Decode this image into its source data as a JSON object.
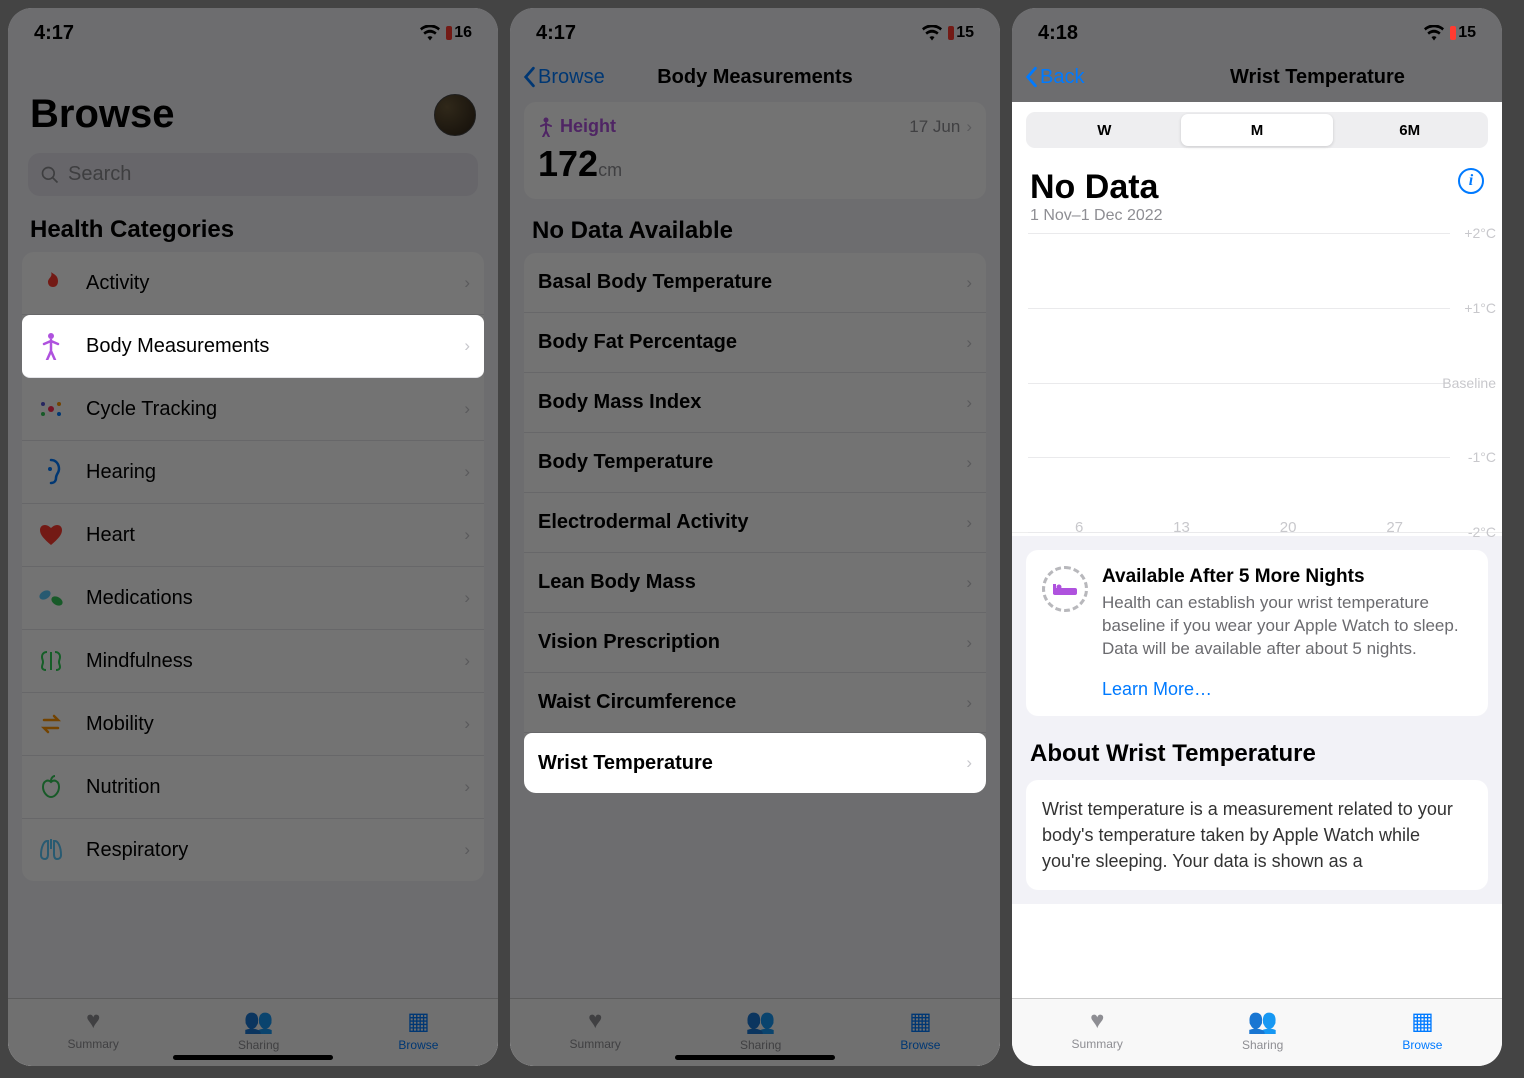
{
  "panel1": {
    "status": {
      "time": "4:17",
      "battery": "16"
    },
    "title": "Browse",
    "search_placeholder": "Search",
    "section": "Health Categories",
    "categories": [
      {
        "icon": "flame",
        "label": "Activity",
        "color": "#ff3b30"
      },
      {
        "icon": "body",
        "label": "Body Measurements",
        "color": "#af52de",
        "highlight": true
      },
      {
        "icon": "cycle",
        "label": "Cycle Tracking",
        "color": "#ff2d55"
      },
      {
        "icon": "ear",
        "label": "Hearing",
        "color": "#007aff"
      },
      {
        "icon": "heart",
        "label": "Heart",
        "color": "#ff3b30"
      },
      {
        "icon": "pills",
        "label": "Medications",
        "color": "#34c759"
      },
      {
        "icon": "brain",
        "label": "Mindfulness",
        "color": "#30d158"
      },
      {
        "icon": "arrows",
        "label": "Mobility",
        "color": "#ff9500"
      },
      {
        "icon": "apple",
        "label": "Nutrition",
        "color": "#34c759"
      },
      {
        "icon": "lungs",
        "label": "Respiratory",
        "color": "#5ac8fa"
      }
    ]
  },
  "panel2": {
    "status": {
      "time": "4:17",
      "battery": "15"
    },
    "back": "Browse",
    "title": "Body Measurements",
    "height_card": {
      "label": "Height",
      "date": "17 Jun",
      "value": "172",
      "unit": "cm"
    },
    "no_data_header": "No Data Available",
    "items": [
      {
        "label": "Basal Body Temperature"
      },
      {
        "label": "Body Fat Percentage"
      },
      {
        "label": "Body Mass Index"
      },
      {
        "label": "Body Temperature"
      },
      {
        "label": "Electrodermal Activity"
      },
      {
        "label": "Lean Body Mass"
      },
      {
        "label": "Vision Prescription"
      },
      {
        "label": "Waist Circumference"
      },
      {
        "label": "Wrist Temperature",
        "highlight": true
      }
    ]
  },
  "panel3": {
    "status": {
      "time": "4:18",
      "battery": "15"
    },
    "back": "Back",
    "title": "Wrist Temperature",
    "segments": [
      "W",
      "M",
      "6M"
    ],
    "segment_selected": "M",
    "nodata": "No Data",
    "date_range": "1 Nov–1 Dec 2022",
    "info_card": {
      "title": "Available After 5 More Nights",
      "body": "Health can establish your wrist temperature baseline if you wear your Apple Watch to sleep. Data will be available after about 5 nights.",
      "link": "Learn More…"
    },
    "about_title": "About Wrist Temperature",
    "about_body": "Wrist temperature is a measurement related to your body's temperature taken by Apple Watch while you're sleeping. Your data is shown as a"
  },
  "tabs": {
    "summary": "Summary",
    "sharing": "Sharing",
    "browse": "Browse"
  },
  "chart_data": {
    "type": "line",
    "title": "No Data",
    "date_range": "1 Nov–1 Dec 2022",
    "x_ticks": [
      6,
      13,
      20,
      27
    ],
    "y_ticks": [
      "+2°C",
      "+1°C",
      "Baseline",
      "-1°C",
      "-2°C"
    ],
    "series": [],
    "note": "No data points present"
  }
}
